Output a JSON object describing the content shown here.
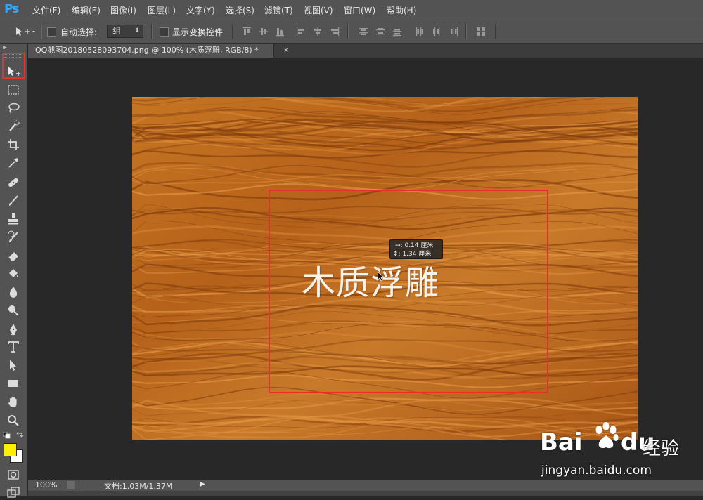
{
  "app": {
    "logo": "Ps"
  },
  "menu": {
    "items": [
      {
        "label": "文件(F)"
      },
      {
        "label": "编辑(E)"
      },
      {
        "label": "图像(I)"
      },
      {
        "label": "图层(L)"
      },
      {
        "label": "文字(Y)"
      },
      {
        "label": "选择(S)"
      },
      {
        "label": "滤镜(T)"
      },
      {
        "label": "视图(V)"
      },
      {
        "label": "窗口(W)"
      },
      {
        "label": "帮助(H)"
      }
    ]
  },
  "options": {
    "auto_select_label": "自动选择:",
    "auto_select_checked": false,
    "group_value": "组",
    "show_transform_label": "显示变换控件",
    "show_transform_checked": false
  },
  "document": {
    "tab_title": "QQ截图20180528093704.png @ 100% (木质浮雕, RGB/8) *",
    "tab_close": "×",
    "text_layer": "木质浮雕"
  },
  "tooltip": {
    "line1": "|↔: 0.14 厘米",
    "line2": "↕: 1.34 厘米"
  },
  "status": {
    "zoom": "100%",
    "doc_size": "文档:1.03M/1.37M",
    "arrow": "▶"
  },
  "toolbar": {
    "collapse": "▸▸",
    "active_tool": "move-tool",
    "foreground_color": "#ffef00",
    "background_color": "#ffffff",
    "tools": [
      "move-tool",
      "marquee-tool",
      "lasso-tool",
      "quick-selection-tool",
      "crop-tool",
      "eyedropper-tool",
      "healing-brush-tool",
      "brush-tool",
      "clone-stamp-tool",
      "history-brush-tool",
      "eraser-tool",
      "paint-bucket-tool",
      "blur-tool",
      "dodge-tool",
      "pen-tool",
      "type-tool",
      "path-selection-tool",
      "rectangle-tool",
      "hand-tool",
      "zoom-tool"
    ]
  },
  "colors": {
    "highlight": "#e8302a",
    "wood_base": "#b8641c",
    "ps_blue": "#31a8ff"
  },
  "watermark": {
    "brand_bai": "Bai",
    "brand_du": "du",
    "brand_cn": "经验",
    "url": "jingyan.baidu.com"
  }
}
